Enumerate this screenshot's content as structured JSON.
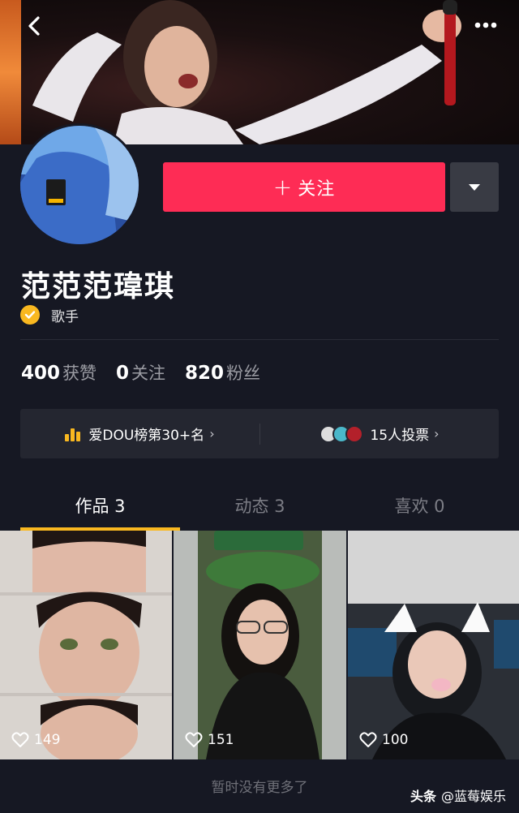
{
  "header": {
    "back_icon": "chevron-left-icon",
    "more_icon": "more-dots-icon"
  },
  "profile": {
    "name": "范范范瑋琪",
    "verify_label": "歌手",
    "follow_label": "关注",
    "follow_plus": "+"
  },
  "stats": [
    {
      "num": "400",
      "label": "获赞"
    },
    {
      "num": "0",
      "label": "关注"
    },
    {
      "num": "820",
      "label": "粉丝"
    }
  ],
  "rank": {
    "left_label": "爱DOU榜第30+名",
    "right_label": "15人投票",
    "chevron": "›"
  },
  "tabs": [
    {
      "label": "作品 3",
      "active": true
    },
    {
      "label": "动态 3",
      "active": false
    },
    {
      "label": "喜欢 0",
      "active": false
    }
  ],
  "videos": [
    {
      "likes": "149"
    },
    {
      "likes": "151"
    },
    {
      "likes": "100"
    }
  ],
  "footer": {
    "no_more": "暂时没有更多了",
    "watermark_brand": "头条",
    "watermark_handle": "@蓝莓娱乐"
  },
  "colors": {
    "follow": "#fe2c55",
    "accent": "#f9b820",
    "bg": "#161823"
  }
}
